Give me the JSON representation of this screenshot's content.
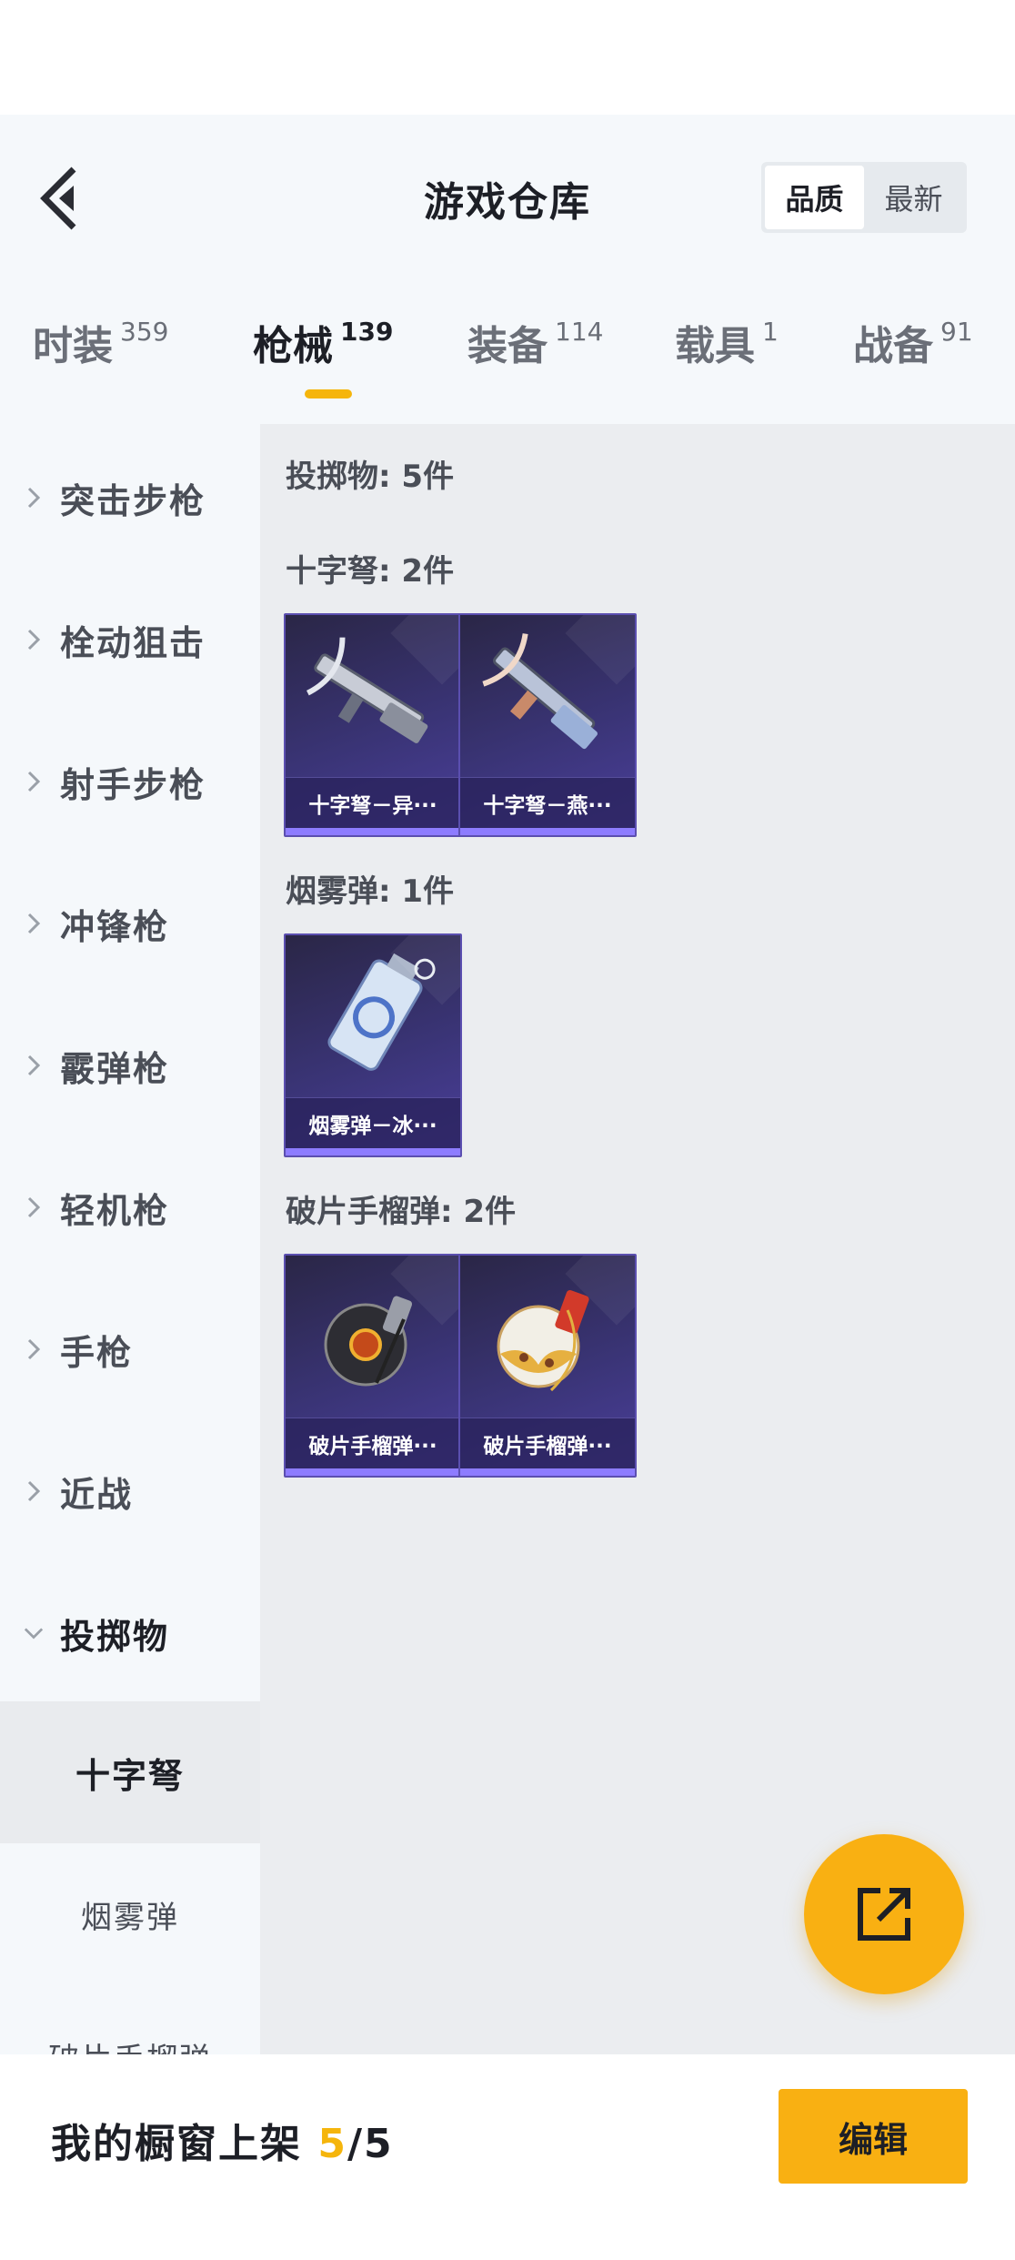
{
  "header": {
    "title": "游戏仓库",
    "sort_options": [
      "品质",
      "最新"
    ],
    "active_sort": "品质"
  },
  "tabs": [
    {
      "label": "时装",
      "count": "359"
    },
    {
      "label": "枪械",
      "count": "139"
    },
    {
      "label": "装备",
      "count": "114"
    },
    {
      "label": "载具",
      "count": "1"
    },
    {
      "label": "战备",
      "count": "91"
    }
  ],
  "active_tab": "枪械",
  "sidebar": {
    "categories": [
      {
        "label": "突击步枪"
      },
      {
        "label": "栓动狙击"
      },
      {
        "label": "射手步枪"
      },
      {
        "label": "冲锋枪"
      },
      {
        "label": "霰弹枪"
      },
      {
        "label": "轻机枪"
      },
      {
        "label": "手枪"
      },
      {
        "label": "近战"
      },
      {
        "label": "投掷物"
      }
    ],
    "subcategories": [
      {
        "label": "十字弩"
      },
      {
        "label": "烟雾弹"
      },
      {
        "label": "破片手榴弹"
      }
    ],
    "selected_sub": "十字弩"
  },
  "content": {
    "summary": "投掷物: 5件",
    "sections": [
      {
        "title": "十字弩: 2件",
        "items": [
          {
            "name": "十字弩－异···",
            "icon": "crossbow-icon"
          },
          {
            "name": "十字弩－燕···",
            "icon": "crossbow-icon"
          }
        ]
      },
      {
        "title": "烟雾弹: 1件",
        "items": [
          {
            "name": "烟雾弹－冰···",
            "icon": "smoke-grenade-icon"
          }
        ]
      },
      {
        "title": "破片手榴弹: 2件",
        "items": [
          {
            "name": "破片手榴弹···",
            "icon": "frag-grenade-icon"
          },
          {
            "name": "破片手榴弹···",
            "icon": "frag-grenade-icon"
          }
        ]
      }
    ]
  },
  "bottom": {
    "shelf_label": "我的橱窗上架",
    "shelf_current": "5",
    "shelf_total": "/5",
    "edit_label": "编辑"
  },
  "colors": {
    "accent": "#f9b012",
    "card_bg": "#3a3476",
    "rarity": "#8d7cff"
  }
}
